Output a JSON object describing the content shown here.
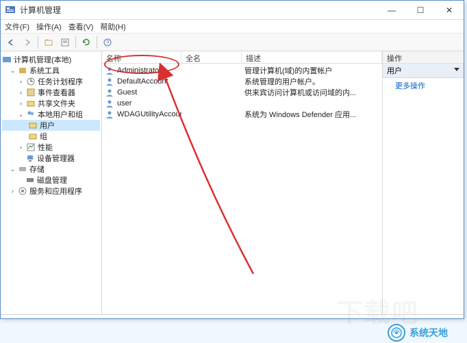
{
  "window": {
    "title": "计算机管理",
    "controls": {
      "min": "—",
      "max": "☐",
      "close": "✕"
    }
  },
  "menu": {
    "file": "文件(F)",
    "action": "操作(A)",
    "view": "查看(V)",
    "help": "帮助(H)"
  },
  "tree": {
    "root": "计算机管理(本地)",
    "sys_tools": "系统工具",
    "task_sched": "任务计划程序",
    "event_viewer": "事件查看器",
    "shared_folders": "共享文件夹",
    "local_users": "本地用户和组",
    "users": "用户",
    "groups": "组",
    "perf": "性能",
    "devmgr": "设备管理器",
    "storage": "存储",
    "diskmgr": "磁盘管理",
    "services": "服务和应用程序"
  },
  "list": {
    "headers": {
      "name": "名称",
      "fullname": "全名",
      "desc": "描述"
    },
    "rows": [
      {
        "name": "Administrator",
        "fullname": "",
        "desc": "管理计算机(域)的内置帐户"
      },
      {
        "name": "DefaultAccount",
        "fullname": "",
        "desc": "系统管理的用户帐户。"
      },
      {
        "name": "Guest",
        "fullname": "",
        "desc": "供来宾访问计算机或访问域的内..."
      },
      {
        "name": "user",
        "fullname": "",
        "desc": ""
      },
      {
        "name": "WDAGUtilityAccount",
        "fullname": "",
        "desc": "系统为 Windows Defender 应用..."
      }
    ]
  },
  "actions": {
    "header": "操作",
    "section": "用户",
    "more": "更多操作"
  },
  "watermark": {
    "text": "系统天地"
  },
  "faded": "下载吧"
}
